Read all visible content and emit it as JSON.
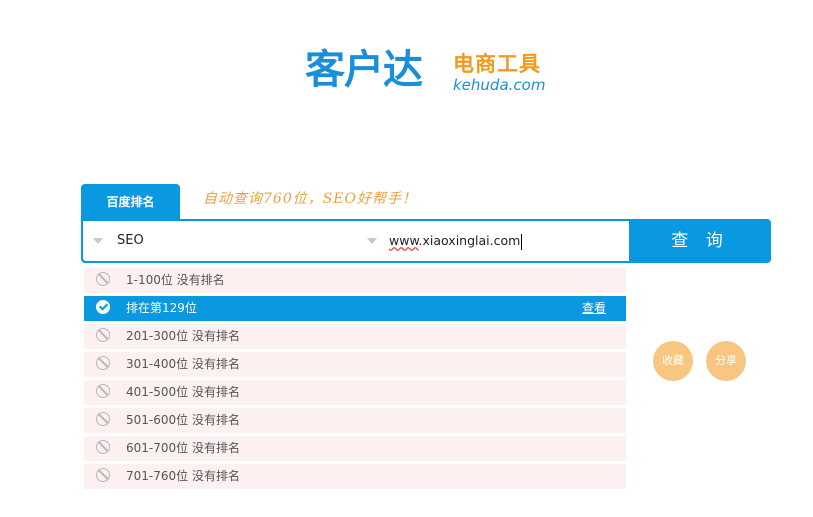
{
  "logo": {
    "main": "客户达",
    "sub": "电商工具",
    "domain": "kehuda.com"
  },
  "tab": {
    "label": "百度排名"
  },
  "slogan": "自动查询760位，SEO好帮手！",
  "search": {
    "engine_value": "SEO",
    "url_www": "www",
    "url_rest": ".xiaoxinglai.com",
    "query_button": "查 询"
  },
  "results": [
    {
      "label": "1-100位 没有排名",
      "status": "none"
    },
    {
      "label": "排在第129位",
      "status": "found",
      "link": "查看"
    },
    {
      "label": "201-300位 没有排名",
      "status": "none"
    },
    {
      "label": "301-400位 没有排名",
      "status": "none"
    },
    {
      "label": "401-500位 没有排名",
      "status": "none"
    },
    {
      "label": "501-600位 没有排名",
      "status": "none"
    },
    {
      "label": "601-700位 没有排名",
      "status": "none"
    },
    {
      "label": "701-760位 没有排名",
      "status": "none"
    }
  ],
  "actions": {
    "favorite": "收藏",
    "share": "分享"
  },
  "colors": {
    "primary": "#0a99e0",
    "logo_blue": "#1a8fd8",
    "logo_orange": "#f39a1c",
    "circle_button": "#f8c680",
    "row_background": "#fdf0f0"
  }
}
